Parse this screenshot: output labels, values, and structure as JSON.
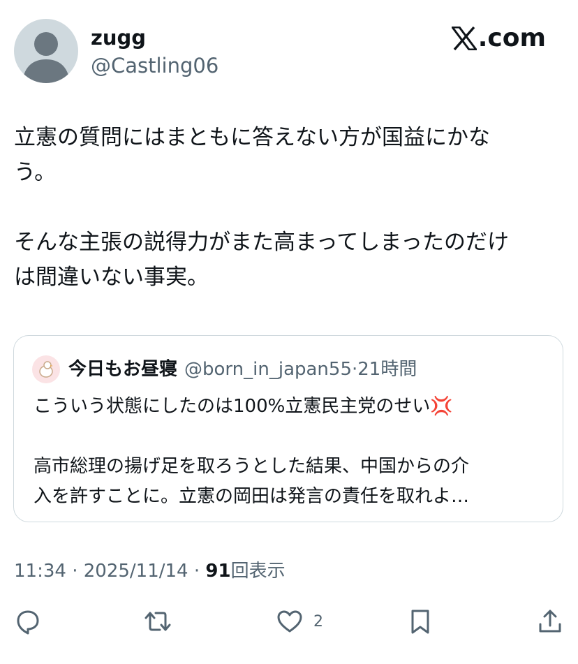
{
  "author": {
    "name": "zugg",
    "handle": "@Castling06"
  },
  "brand": {
    "label": ".com",
    "icon": "x-logo-icon"
  },
  "post": {
    "line1": "立憲の質問にはまともに答えない方が国益にかな",
    "line2": "う。",
    "line3": "そんな主張の説得力がまた高まってしまったのだけ",
    "line4": "は間違いない事実。"
  },
  "quote": {
    "name": "今日もお昼寝",
    "handle": "@born_in_japan55",
    "separator": "·",
    "time": "21時間",
    "line1": "こういう状態にしたのは100%立憲民主党のせい",
    "emoji": "💢",
    "line2": "高市総理の揚げ足を取ろうとした結果、中国からの介",
    "line3": "入を許すことに。立憲の岡田は発言の責任を取れよ…"
  },
  "meta": {
    "time": "11:34",
    "separator": "·",
    "date": "2025/11/14",
    "views": "91",
    "views_label": "回表示"
  },
  "actions": {
    "reply": "",
    "repost": "",
    "like_count": "2",
    "bookmark": "",
    "share": ""
  },
  "colors": {
    "secondary": "#536471",
    "border": "#cfd9de",
    "text": "#0f1419",
    "anger": "#e0245e"
  }
}
